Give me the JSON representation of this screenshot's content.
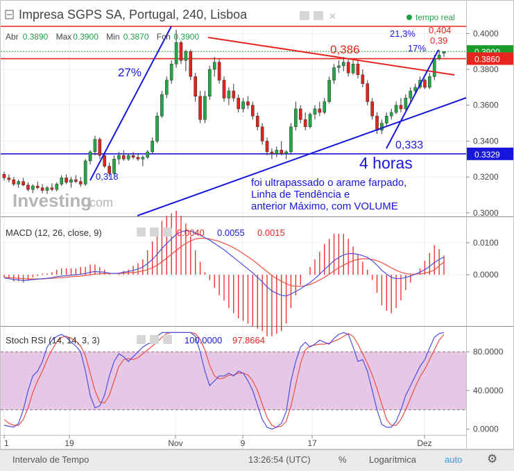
{
  "header": {
    "title": "Impresa SGPS SA, Portugal, 240, Lisboa",
    "realtime_label": "tempo real",
    "ohlc": [
      {
        "label": "Abr",
        "value": "0.3890"
      },
      {
        "label": "Max",
        "value": "0.3900"
      },
      {
        "label": "Min",
        "value": "0.3870"
      },
      {
        "label": "Fch",
        "value": "0.3900"
      }
    ]
  },
  "price_axis": {
    "ticks": [
      "0.4000",
      "0.3800",
      "0.3600",
      "0.3400",
      "0.3200",
      "0.3000"
    ],
    "badges": [
      {
        "value": "0.3900",
        "color": "#1a9c2a"
      },
      {
        "value": "0.3860",
        "color": "#e8241e"
      },
      {
        "value": "0.3329",
        "color": "#1616dd"
      }
    ]
  },
  "annotations": {
    "pct27": "27%",
    "low318": "0,318",
    "level386": "0,386",
    "level333": "0,333",
    "pct213": "21,3%",
    "pct17": "17%",
    "level404": "0,404",
    "level39": "0,39",
    "four_hours": "4 horas",
    "comment": [
      "foi ultrapassado o arame farpado,",
      "Linha de Tendência e",
      "anterior Máximo, com VOLUME"
    ]
  },
  "watermark": {
    "brand": "Investing",
    "suffix": ".com"
  },
  "macd": {
    "label": "MACD (12, 26, close, 9)",
    "values": [
      "0.0040",
      "0.0055",
      "0.0015"
    ],
    "value_colors": [
      "#e8241e",
      "#1616dd",
      "#e8241e"
    ],
    "ticks": [
      "0.0100",
      "0.0000"
    ]
  },
  "stoch": {
    "label": "Stoch RSI (14, 14, 3, 3)",
    "values": [
      "100.0000",
      "97.8664"
    ],
    "value_colors": [
      "#1616dd",
      "#e8241e"
    ],
    "ticks": [
      "80.0000",
      "40.0000",
      "0.0000"
    ]
  },
  "time_axis": [
    "1",
    "19",
    "Nov",
    "9",
    "17",
    "Dez"
  ],
  "bottom_bar": {
    "interval": "Intervalo de Tempo",
    "time": "13:26:54 (UTC)",
    "percent": "%",
    "log": "Logarítmica",
    "auto": "auto"
  },
  "chart_data": {
    "type": "candlestick",
    "title": "Impresa SGPS SA, Portugal, 240, Lisboa",
    "ylim": [
      0.298,
      0.404
    ],
    "candles_ohlc": [
      [
        0.3215,
        0.323,
        0.318,
        0.3195
      ],
      [
        0.3195,
        0.3215,
        0.317,
        0.3185
      ],
      [
        0.3185,
        0.32,
        0.315,
        0.316
      ],
      [
        0.316,
        0.3185,
        0.314,
        0.3175
      ],
      [
        0.3175,
        0.3195,
        0.315,
        0.3155
      ],
      [
        0.3155,
        0.317,
        0.312,
        0.313
      ],
      [
        0.313,
        0.316,
        0.311,
        0.315
      ],
      [
        0.315,
        0.3175,
        0.313,
        0.314
      ],
      [
        0.314,
        0.316,
        0.311,
        0.3125
      ],
      [
        0.3125,
        0.315,
        0.3105,
        0.314
      ],
      [
        0.314,
        0.3165,
        0.312,
        0.313
      ],
      [
        0.313,
        0.317,
        0.312,
        0.316
      ],
      [
        0.316,
        0.321,
        0.315,
        0.3195
      ],
      [
        0.3195,
        0.3215,
        0.316,
        0.317
      ],
      [
        0.317,
        0.32,
        0.314,
        0.3185
      ],
      [
        0.3185,
        0.321,
        0.3165,
        0.3175
      ],
      [
        0.3175,
        0.32,
        0.3145,
        0.316
      ],
      [
        0.316,
        0.33,
        0.315,
        0.329
      ],
      [
        0.329,
        0.335,
        0.327,
        0.334
      ],
      [
        0.334,
        0.343,
        0.332,
        0.341
      ],
      [
        0.341,
        0.342,
        0.33,
        0.332
      ],
      [
        0.332,
        0.334,
        0.325,
        0.326
      ],
      [
        0.326,
        0.328,
        0.32,
        0.322
      ],
      [
        0.322,
        0.332,
        0.321,
        0.33
      ],
      [
        0.33,
        0.334,
        0.327,
        0.332
      ],
      [
        0.332,
        0.335,
        0.329,
        0.33
      ],
      [
        0.33,
        0.333,
        0.329,
        0.332
      ],
      [
        0.332,
        0.334,
        0.33,
        0.331
      ],
      [
        0.331,
        0.333,
        0.329,
        0.33
      ],
      [
        0.33,
        0.332,
        0.326,
        0.331
      ],
      [
        0.331,
        0.335,
        0.33,
        0.334
      ],
      [
        0.334,
        0.342,
        0.333,
        0.34
      ],
      [
        0.34,
        0.356,
        0.339,
        0.354
      ],
      [
        0.354,
        0.368,
        0.353,
        0.366
      ],
      [
        0.366,
        0.376,
        0.364,
        0.374
      ],
      [
        0.374,
        0.385,
        0.372,
        0.383
      ],
      [
        0.383,
        0.402,
        0.381,
        0.395
      ],
      [
        0.395,
        0.396,
        0.383,
        0.385
      ],
      [
        0.385,
        0.391,
        0.379,
        0.39
      ],
      [
        0.39,
        0.391,
        0.374,
        0.376
      ],
      [
        0.376,
        0.378,
        0.362,
        0.365
      ],
      [
        0.365,
        0.368,
        0.35,
        0.352
      ],
      [
        0.352,
        0.368,
        0.35,
        0.365
      ],
      [
        0.365,
        0.382,
        0.363,
        0.38
      ],
      [
        0.38,
        0.387,
        0.376,
        0.384
      ],
      [
        0.384,
        0.386,
        0.372,
        0.374
      ],
      [
        0.374,
        0.376,
        0.362,
        0.364
      ],
      [
        0.364,
        0.37,
        0.36,
        0.368
      ],
      [
        0.368,
        0.372,
        0.362,
        0.364
      ],
      [
        0.364,
        0.366,
        0.356,
        0.358
      ],
      [
        0.358,
        0.364,
        0.356,
        0.362
      ],
      [
        0.362,
        0.365,
        0.358,
        0.36
      ],
      [
        0.36,
        0.362,
        0.352,
        0.354
      ],
      [
        0.354,
        0.356,
        0.346,
        0.348
      ],
      [
        0.348,
        0.35,
        0.338,
        0.34
      ],
      [
        0.34,
        0.342,
        0.332,
        0.334
      ],
      [
        0.334,
        0.336,
        0.33,
        0.333
      ],
      [
        0.333,
        0.337,
        0.331,
        0.335
      ],
      [
        0.335,
        0.34,
        0.332,
        0.333
      ],
      [
        0.333,
        0.335,
        0.33,
        0.334
      ],
      [
        0.334,
        0.35,
        0.333,
        0.348
      ],
      [
        0.348,
        0.362,
        0.346,
        0.358
      ],
      [
        0.358,
        0.36,
        0.35,
        0.352
      ],
      [
        0.352,
        0.356,
        0.346,
        0.348
      ],
      [
        0.348,
        0.356,
        0.347,
        0.355
      ],
      [
        0.355,
        0.36,
        0.352,
        0.358
      ],
      [
        0.358,
        0.362,
        0.354,
        0.356
      ],
      [
        0.356,
        0.364,
        0.355,
        0.362
      ],
      [
        0.362,
        0.376,
        0.361,
        0.374
      ],
      [
        0.374,
        0.383,
        0.372,
        0.381
      ],
      [
        0.381,
        0.385,
        0.378,
        0.382
      ],
      [
        0.382,
        0.387,
        0.379,
        0.384
      ],
      [
        0.384,
        0.386,
        0.376,
        0.378
      ],
      [
        0.378,
        0.385,
        0.377,
        0.383
      ],
      [
        0.383,
        0.385,
        0.375,
        0.377
      ],
      [
        0.377,
        0.38,
        0.37,
        0.372
      ],
      [
        0.372,
        0.374,
        0.36,
        0.362
      ],
      [
        0.362,
        0.364,
        0.352,
        0.354
      ],
      [
        0.354,
        0.356,
        0.344,
        0.346
      ],
      [
        0.346,
        0.352,
        0.344,
        0.35
      ],
      [
        0.35,
        0.356,
        0.348,
        0.354
      ],
      [
        0.354,
        0.358,
        0.352,
        0.356
      ],
      [
        0.356,
        0.362,
        0.355,
        0.36
      ],
      [
        0.36,
        0.364,
        0.356,
        0.358
      ],
      [
        0.358,
        0.366,
        0.357,
        0.364
      ],
      [
        0.364,
        0.37,
        0.362,
        0.368
      ],
      [
        0.368,
        0.372,
        0.366,
        0.37
      ],
      [
        0.37,
        0.376,
        0.369,
        0.374
      ],
      [
        0.374,
        0.375,
        0.369,
        0.37
      ],
      [
        0.37,
        0.378,
        0.369,
        0.376
      ],
      [
        0.376,
        0.388,
        0.374,
        0.386
      ],
      [
        0.386,
        0.391,
        0.385,
        0.388
      ],
      [
        0.389,
        0.39,
        0.387,
        0.39
      ]
    ],
    "horizontal_levels": [
      {
        "value": 0.404,
        "color": "#e8241e"
      },
      {
        "value": 0.386,
        "color": "#e8241e"
      },
      {
        "value": 0.3329,
        "color": "#1616dd"
      },
      {
        "value": 0.39,
        "color": "#1a9c2a",
        "style": "dotted"
      }
    ],
    "macd": {
      "ylim": [
        -0.016,
        0.018
      ],
      "macd_line": [
        -0.001,
        -0.0012,
        -0.0015,
        -0.0016,
        -0.0018,
        -0.0017,
        -0.0015,
        -0.0014,
        -0.0012,
        -0.0011,
        -0.0009,
        -0.0006,
        -0.0004,
        -0.0003,
        -0.0001,
        0.0,
        0.0002,
        0.0004,
        0.0008,
        0.001,
        0.0009,
        0.0008,
        0.0005,
        0.0004,
        0.0005,
        0.0008,
        0.001,
        0.0014,
        0.0018,
        0.0024,
        0.0035,
        0.0048,
        0.0064,
        0.0082,
        0.0098,
        0.0112,
        0.0126,
        0.0134,
        0.0138,
        0.0136,
        0.0131,
        0.0124,
        0.0116,
        0.0108,
        0.0098,
        0.0088,
        0.0078,
        0.0066,
        0.0054,
        0.0042,
        0.003,
        0.0018,
        0.0006,
        -0.0008,
        -0.0022,
        -0.0038,
        -0.005,
        -0.0058,
        -0.0064,
        -0.0066,
        -0.006,
        -0.0052,
        -0.0044,
        -0.0034,
        -0.0024,
        -0.0012,
        0.0002,
        0.0016,
        0.003,
        0.0044,
        0.0054,
        0.0062,
        0.0066,
        0.0066,
        0.0064,
        0.006,
        0.0054,
        0.0044,
        0.003,
        0.0014,
        0.0002,
        -0.0008,
        -0.0012,
        -0.0012,
        -0.0008,
        -0.0004,
        0.0002,
        0.0008,
        0.0016,
        0.0026,
        0.0038,
        0.0048,
        0.0055
      ],
      "signal_line": [
        -0.0008,
        -0.0009,
        -0.001,
        -0.0011,
        -0.0012,
        -0.0013,
        -0.0013,
        -0.0013,
        -0.0013,
        -0.0012,
        -0.0011,
        -0.001,
        -0.0009,
        -0.0008,
        -0.0006,
        -0.0005,
        -0.0004,
        -0.0002,
        0.0,
        0.0002,
        0.0003,
        0.0004,
        0.0004,
        0.0004,
        0.0004,
        0.0005,
        0.0006,
        0.0007,
        0.0009,
        0.0012,
        0.0016,
        0.0022,
        0.003,
        0.004,
        0.0052,
        0.0064,
        0.0076,
        0.0088,
        0.0098,
        0.0106,
        0.0112,
        0.0114,
        0.0114,
        0.0112,
        0.0108,
        0.0104,
        0.0098,
        0.0092,
        0.0084,
        0.0076,
        0.0066,
        0.0056,
        0.0046,
        0.0034,
        0.0022,
        0.001,
        -0.0002,
        -0.0012,
        -0.002,
        -0.0028,
        -0.0034,
        -0.0036,
        -0.0036,
        -0.0034,
        -0.003,
        -0.0024,
        -0.0016,
        -0.0008,
        0.0002,
        0.0012,
        0.0022,
        0.003,
        0.0038,
        0.0044,
        0.0048,
        0.005,
        0.005,
        0.0048,
        0.0044,
        0.0038,
        0.003,
        0.0022,
        0.0014,
        0.0008,
        0.0004,
        0.0002,
        0.0002,
        0.0003,
        0.0005,
        0.0009,
        0.0015,
        0.0028,
        0.004
      ],
      "hist_color": "#e8241e",
      "macd_color": "#4d4de0",
      "signal_color": "#ef4d40"
    },
    "stoch_rsi": {
      "ylim": [
        -6,
        106
      ],
      "band": [
        20,
        80
      ],
      "k": [
        4,
        3,
        2,
        6,
        20,
        40,
        55,
        60,
        70,
        85,
        92,
        96,
        98,
        95,
        90,
        86,
        80,
        60,
        35,
        22,
        24,
        35,
        55,
        70,
        78,
        75,
        70,
        75,
        80,
        85,
        88,
        90,
        96,
        100,
        100,
        100,
        100,
        100,
        100,
        100,
        96,
        80,
        60,
        45,
        50,
        55,
        55,
        58,
        55,
        60,
        58,
        50,
        40,
        25,
        10,
        2,
        0,
        2,
        6,
        18,
        50,
        70,
        85,
        90,
        85,
        88,
        92,
        90,
        88,
        94,
        98,
        100,
        98,
        85,
        70,
        72,
        60,
        40,
        20,
        5,
        2,
        2,
        8,
        20,
        35,
        45,
        55,
        65,
        72,
        84,
        95,
        99,
        100
      ],
      "d": [
        10,
        6,
        4,
        4,
        10,
        22,
        38,
        50,
        60,
        72,
        82,
        90,
        95,
        96,
        94,
        91,
        86,
        76,
        58,
        40,
        28,
        27,
        35,
        50,
        65,
        72,
        73,
        72,
        74,
        78,
        82,
        86,
        90,
        95,
        99,
        100,
        100,
        100,
        100,
        100,
        99,
        93,
        82,
        66,
        55,
        52,
        53,
        56,
        56,
        58,
        58,
        56,
        50,
        40,
        26,
        12,
        4,
        2,
        3,
        8,
        24,
        46,
        68,
        82,
        86,
        87,
        88,
        88,
        89,
        91,
        93,
        96,
        99,
        96,
        88,
        78,
        68,
        56,
        42,
        26,
        10,
        4,
        4,
        10,
        20,
        32,
        44,
        54,
        62,
        72,
        82,
        92,
        98
      ],
      "k_color": "#4d4de0",
      "d_color": "#ef4d40",
      "band_color": "#e6c8e6"
    }
  }
}
